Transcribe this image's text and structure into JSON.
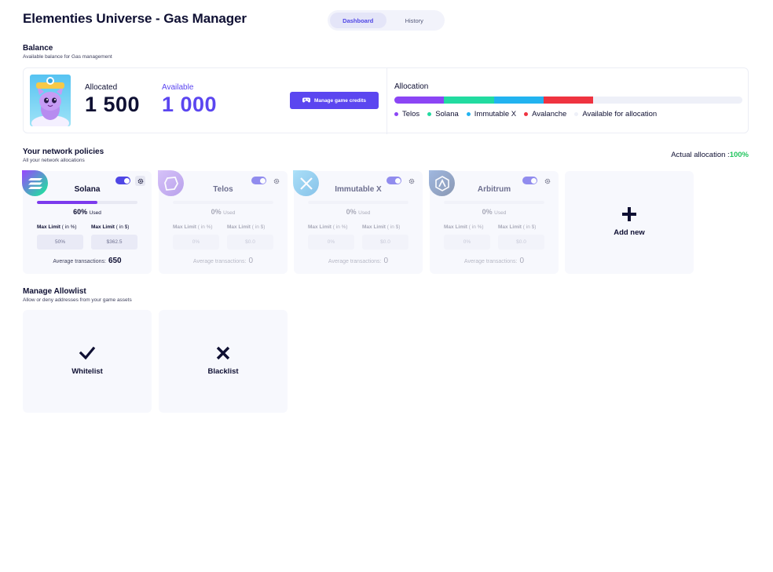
{
  "header": {
    "title": "Elementies Universe - Gas Manager"
  },
  "tabs": [
    {
      "label": "Dashboard",
      "active": true
    },
    {
      "label": "History",
      "active": false
    }
  ],
  "balance": {
    "title": "Balance",
    "subtitle": "Available balance for Gas management",
    "allocated_label": "Allocated",
    "allocated_value": "1 500",
    "available_label": "Available",
    "available_value": "1 000",
    "manage_button": "Manage game credits",
    "allocation": {
      "title": "Allocation",
      "segments": [
        {
          "name": "Telos",
          "color": "#8b45f5",
          "fraction": 0.143
        },
        {
          "name": "Solana",
          "color": "#22dba0",
          "fraction": 0.143
        },
        {
          "name": "Immutable X",
          "color": "#22b3f0",
          "fraction": 0.143
        },
        {
          "name": "Avalanche",
          "color": "#ef3340",
          "fraction": 0.143
        },
        {
          "name": "Available for allocation",
          "color": "#eef0f8",
          "fraction": 0.428
        }
      ]
    }
  },
  "policies": {
    "title": "Your network policies",
    "subtitle": "All your network allocations",
    "actual_label": "Actual allocation :",
    "actual_value": "100%",
    "max_limit_pct_label": "Max Limit",
    "max_limit_pct_unit": "( in %)",
    "max_limit_usd_label": "Max Limit",
    "max_limit_usd_unit": "( in $)",
    "used_suffix": "Used",
    "avg_label": "Average transactions:",
    "networks": [
      {
        "name": "Solana",
        "used": "60%",
        "used_fraction": 0.6,
        "limit_pct": "50%",
        "limit_usd": "$362.5",
        "avg": "650",
        "enabled": true,
        "icon": "solana-logo-icon",
        "color": "#7c3aed"
      },
      {
        "name": "Telos",
        "used": "0%",
        "used_fraction": 0,
        "limit_pct": "0%",
        "limit_usd": "$0.0",
        "avg": "0",
        "enabled": true,
        "icon": "telos-logo-icon",
        "color": "#8b5cf6"
      },
      {
        "name": "Immutable X",
        "used": "0%",
        "used_fraction": 0,
        "limit_pct": "0%",
        "limit_usd": "$0.0",
        "avg": "0",
        "enabled": true,
        "icon": "immutable-x-logo-icon",
        "color": "#1ea7e8"
      },
      {
        "name": "Arbitrum",
        "used": "0%",
        "used_fraction": 0,
        "limit_pct": "0%",
        "limit_usd": "$0.0",
        "avg": "0",
        "enabled": true,
        "icon": "arbitrum-logo-icon",
        "color": "#2d5fa8"
      }
    ],
    "add_label": "Add new"
  },
  "allowlist": {
    "title": "Manage Allowlist",
    "subtitle": "Allow or deny addresses from your game assets",
    "whitelist_label": "Whitelist",
    "blacklist_label": "Blacklist"
  }
}
